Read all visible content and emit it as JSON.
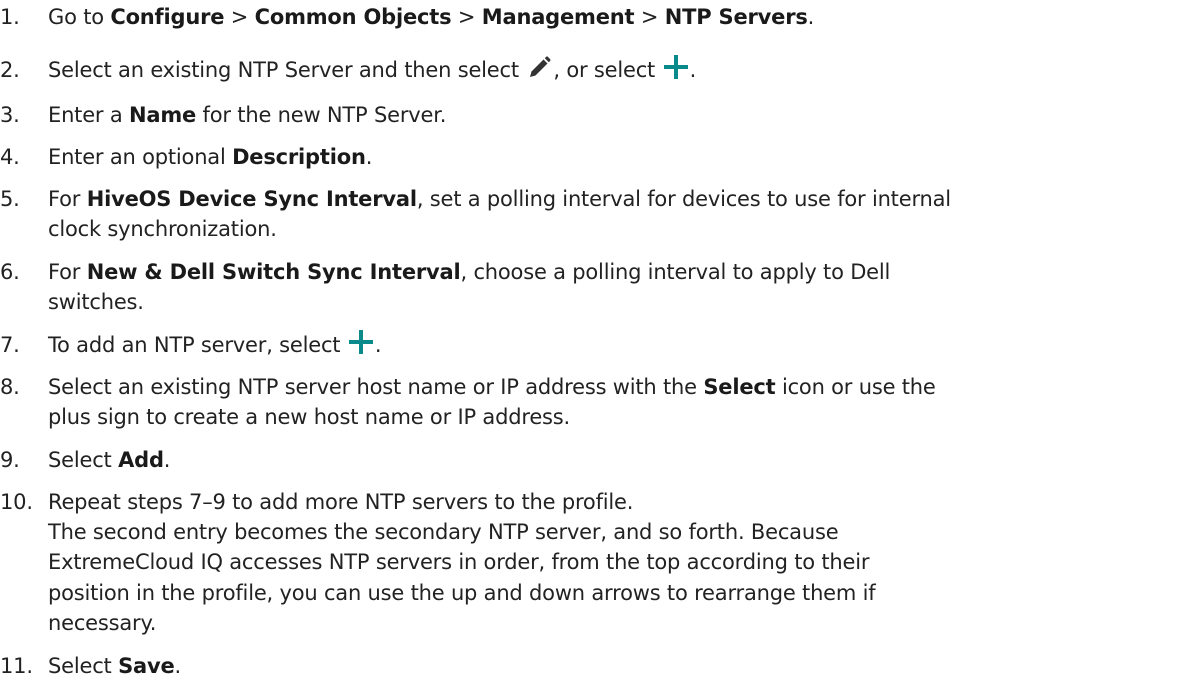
{
  "steps": [
    {
      "number": "1.",
      "parts": [
        {
          "t": "Go to "
        },
        {
          "b": "Configure"
        },
        {
          "t": " > "
        },
        {
          "b": "Common Objects"
        },
        {
          "t": " > "
        },
        {
          "b": "Management"
        },
        {
          "t": " > "
        },
        {
          "b": "NTP Servers"
        },
        {
          "t": "."
        }
      ]
    },
    {
      "number": "2.",
      "parts": [
        {
          "t": "Select an existing NTP Server and then select "
        },
        {
          "icon": "pencil-icon"
        },
        {
          "t": ", or select "
        },
        {
          "icon": "plus-icon"
        },
        {
          "t": "."
        }
      ]
    },
    {
      "number": "3.",
      "parts": [
        {
          "t": "Enter a "
        },
        {
          "b": "Name"
        },
        {
          "t": " for the new NTP Server."
        }
      ]
    },
    {
      "number": "4.",
      "parts": [
        {
          "t": "Enter an optional "
        },
        {
          "b": "Description"
        },
        {
          "t": "."
        }
      ]
    },
    {
      "number": "5.",
      "parts": [
        {
          "t": "For "
        },
        {
          "b": "HiveOS Device Sync Interval"
        },
        {
          "t": ", set a polling interval for devices to use for internal"
        }
      ],
      "continuation": [
        [
          {
            "t": "clock synchronization."
          }
        ]
      ]
    },
    {
      "number": "6.",
      "parts": [
        {
          "t": "For "
        },
        {
          "b": "New & Dell Switch Sync Interval"
        },
        {
          "t": ", choose a polling interval to apply to Dell"
        }
      ],
      "continuation": [
        [
          {
            "t": "switches."
          }
        ]
      ]
    },
    {
      "number": "7.",
      "parts": [
        {
          "t": "To add an NTP server, select "
        },
        {
          "icon": "plus-icon"
        },
        {
          "t": "."
        }
      ]
    },
    {
      "number": "8.",
      "parts": [
        {
          "t": "Select an existing NTP server host name or IP address with the "
        },
        {
          "b": "Select"
        },
        {
          "t": " icon or use the"
        }
      ],
      "continuation": [
        [
          {
            "t": "plus sign to create a new host name or IP address."
          }
        ]
      ]
    },
    {
      "number": "9.",
      "parts": [
        {
          "t": "Select "
        },
        {
          "b": "Add"
        },
        {
          "t": "."
        }
      ]
    },
    {
      "number": "10.",
      "parts": [
        {
          "t": "Repeat steps 7–9 to add more NTP servers to the profile."
        }
      ],
      "continuation": [
        [
          {
            "t": "The second entry becomes the secondary NTP server, and so forth. Because"
          }
        ],
        [
          {
            "t": "ExtremeCloud IQ accesses NTP servers in order, from the top according to their"
          }
        ],
        [
          {
            "t": "position in the profile, you can use the up and down arrows to rearrange them if"
          }
        ],
        [
          {
            "t": "necessary."
          }
        ]
      ]
    },
    {
      "number": "11.",
      "parts": [
        {
          "t": "Select "
        },
        {
          "b": "Save"
        },
        {
          "t": "."
        }
      ]
    }
  ],
  "icon_colors": {
    "pencil": "#333333",
    "plus": "#0a8a8a"
  }
}
